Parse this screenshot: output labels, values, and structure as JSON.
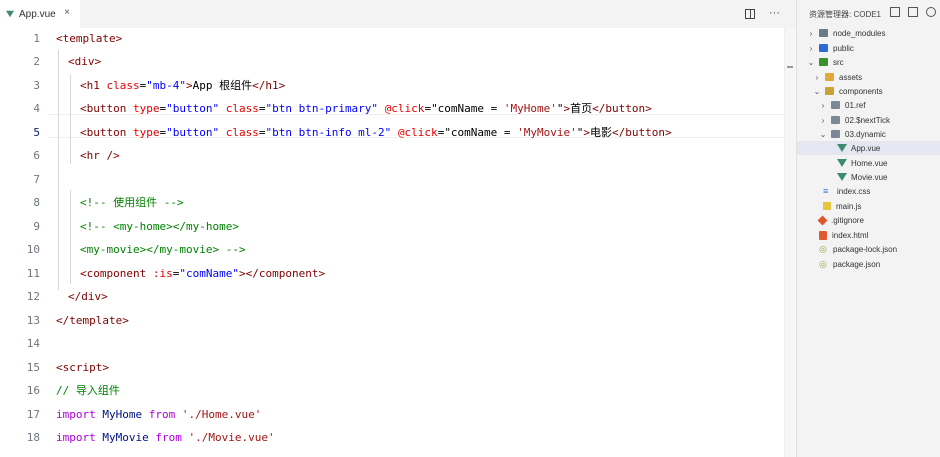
{
  "tab": {
    "label": "App.vue",
    "close": "×"
  },
  "editor_actions": {
    "more": "···"
  },
  "gutter": [
    "1",
    "2",
    "3",
    "4",
    "5",
    "6",
    "7",
    "8",
    "9",
    "10",
    "11",
    "12",
    "13",
    "14",
    "15",
    "16",
    "17",
    "18"
  ],
  "code": {
    "l1": {
      "tag": "<template>"
    },
    "l2": {
      "tag": "<div>"
    },
    "l3": {
      "open": "<h1 ",
      "attr": "class",
      "eq": "=",
      "val": "\"mb-4\"",
      "close": ">",
      "text": "App 根组件",
      "end": "</h1>"
    },
    "l4": {
      "open": "<button ",
      "a1": "type",
      "v1": "\"button\"",
      "a2": "class",
      "v2": "\"btn btn-primary\"",
      "a3": "@click",
      "v3a": "\"comName = ",
      "v3b": "'MyHome'",
      "v3c": "\"",
      "close": ">",
      "text": "首页",
      "end": "</button>"
    },
    "l5": {
      "open": "<button ",
      "a1": "type",
      "v1": "\"button\"",
      "a2": "class",
      "v2": "\"btn btn-info ml-2\"",
      "a3": "@click",
      "v3a": "\"comName = ",
      "v3b": "'MyMovie'",
      "v3c": "\"",
      "close": ">",
      "text": "电影",
      "end": "</button>"
    },
    "l6": {
      "tag": "<hr />"
    },
    "l8": {
      "comment": "<!-- 使用组件 -->"
    },
    "l9": {
      "comment": "<!-- <my-home></my-home>"
    },
    "l10": {
      "comment": "<my-movie></my-movie> -->"
    },
    "l11": {
      "open": "<component ",
      "attr": ":is",
      "eq": "=",
      "val": "\"comName\"",
      "close": ">",
      "end": "</component>"
    },
    "l12": {
      "tag": "</div>"
    },
    "l13": {
      "tag": "</template>"
    },
    "l15": {
      "tag": "<script>"
    },
    "l16": {
      "comment": "// 导入组件"
    },
    "l17": {
      "kw": "import",
      "id": "MyHome",
      "from": "from",
      "path": "'./Home.vue'"
    },
    "l18": {
      "kw": "import",
      "id": "MyMovie",
      "from": "from",
      "path": "'./Movie.vue'"
    }
  },
  "explorer": {
    "title": "资源管理器: CODE1",
    "items": [
      {
        "label": "node_modules",
        "chev": "›"
      },
      {
        "label": "public",
        "chev": "›"
      },
      {
        "label": "src",
        "chev": "⌄"
      },
      {
        "label": "assets",
        "chev": "›"
      },
      {
        "label": "components",
        "chev": "⌄"
      },
      {
        "label": "01.ref",
        "chev": "›"
      },
      {
        "label": "02.$nextTick",
        "chev": "›"
      },
      {
        "label": "03.dynamic",
        "chev": "⌄"
      },
      {
        "label": "App.vue"
      },
      {
        "label": "Home.vue"
      },
      {
        "label": "Movie.vue"
      },
      {
        "label": "index.css"
      },
      {
        "label": "main.js"
      },
      {
        "label": ".gitignore"
      },
      {
        "label": "index.html"
      },
      {
        "label": "package-lock.json"
      },
      {
        "label": "package.json"
      }
    ]
  },
  "colors": {
    "vue": "#3e8b72",
    "keyword": "#af00db",
    "tag": "#800000",
    "attr": "#e50000",
    "string": "#0000ff",
    "comment": "#008000"
  }
}
